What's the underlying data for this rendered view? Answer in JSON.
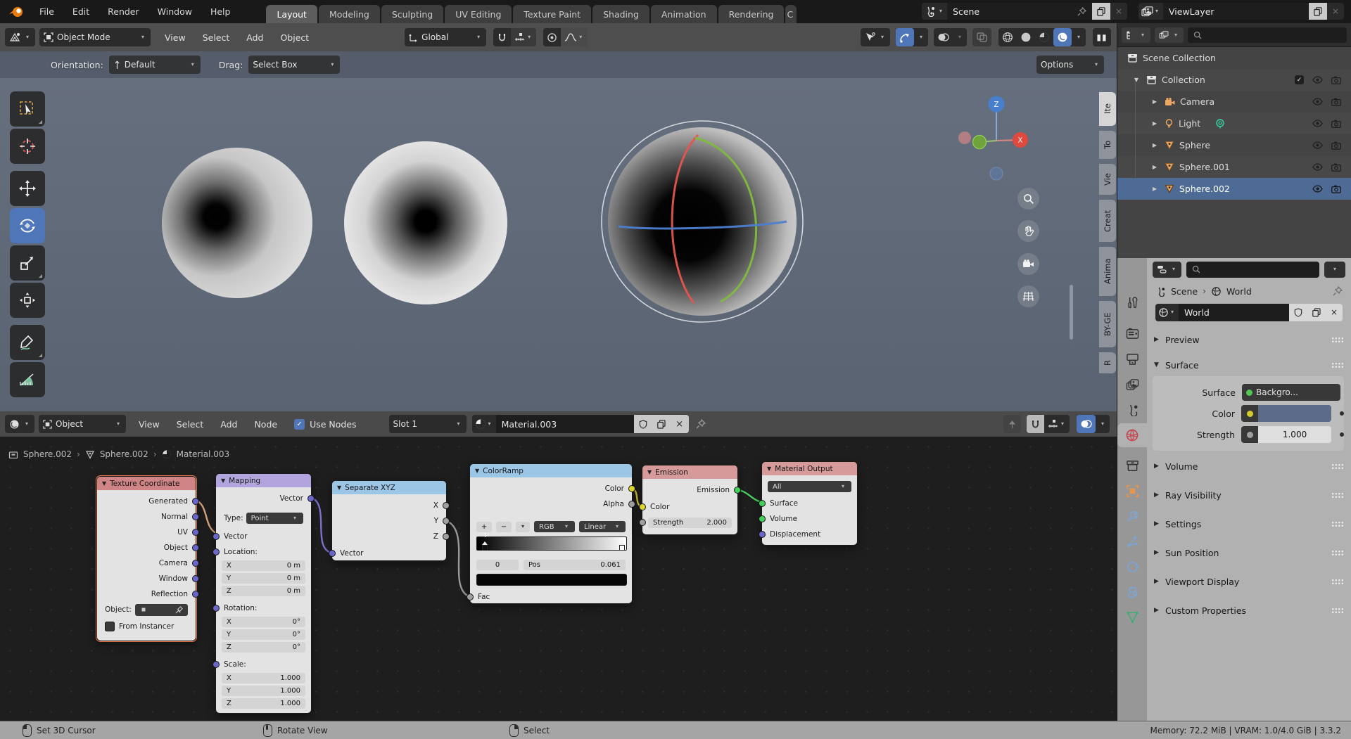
{
  "topbar": {
    "menus": [
      "File",
      "Edit",
      "Render",
      "Window",
      "Help"
    ],
    "tabs": [
      "Layout",
      "Modeling",
      "Sculpting",
      "UV Editing",
      "Texture Paint",
      "Shading",
      "Animation",
      "Rendering",
      "C"
    ],
    "scene": {
      "name": "Scene"
    },
    "view_layer": {
      "name": "ViewLayer"
    }
  },
  "viewport": {
    "header": {
      "mode": "Object Mode",
      "menus": [
        "View",
        "Select",
        "Add",
        "Object"
      ],
      "orientation": "Global"
    },
    "tool_settings": {
      "orientation_label": "Orientation:",
      "orientation_value": "Default",
      "drag_label": "Drag:",
      "drag_value": "Select Box",
      "options": "Options"
    },
    "axis_gizmo": {
      "z": "Z",
      "x": "X"
    },
    "sidebar_tabs": [
      "Ite",
      "To",
      "Vie",
      "Creat",
      "Anima",
      "BY-GE",
      "R"
    ]
  },
  "shader_editor": {
    "header": {
      "type": "Object",
      "menus": [
        "View",
        "Select",
        "Add",
        "Node"
      ],
      "use_nodes": "Use Nodes",
      "slot": "Slot 1",
      "material": "Material.003"
    },
    "breadcrumb": {
      "object": "Sphere.002",
      "data": "Sphere.002",
      "material": "Material.003"
    }
  },
  "nodes": {
    "texture_coordinate": {
      "title": "Texture Coordinate",
      "outputs": [
        "Generated",
        "Normal",
        "UV",
        "Object",
        "Camera",
        "Window",
        "Reflection"
      ],
      "object_label": "Object:",
      "from_instancer": "From Instancer"
    },
    "mapping": {
      "title": "Mapping",
      "output": "Vector",
      "type_label": "Type:",
      "type_value": "Point",
      "input": "Vector",
      "location_label": "Location:",
      "rotation_label": "Rotation:",
      "scale_label": "Scale:",
      "axis_x": "X",
      "axis_y": "Y",
      "axis_z": "Z",
      "location": {
        "x": "0 m",
        "y": "0 m",
        "z": "0 m"
      },
      "rotation": {
        "x": "0°",
        "y": "0°",
        "z": "0°"
      },
      "scale": {
        "x": "1.000",
        "y": "1.000",
        "z": "1.000"
      }
    },
    "separate_xyz": {
      "title": "Separate XYZ",
      "outputs": [
        "X",
        "Y",
        "Z"
      ],
      "input": "Vector"
    },
    "color_ramp": {
      "title": "ColorRamp",
      "outputs": [
        "Color",
        "Alpha"
      ],
      "add": "+",
      "remove": "−",
      "color_mode": "RGB",
      "interpolation": "Linear",
      "index": "0",
      "pos_label": "Pos",
      "pos_value": "0.061",
      "input": "Fac"
    },
    "emission": {
      "title": "Emission",
      "output": "Emission",
      "color_label": "Color",
      "strength_label": "Strength",
      "strength_value": "2.000"
    },
    "material_output": {
      "title": "Material Output",
      "target": "All",
      "inputs": [
        "Surface",
        "Volume",
        "Displacement"
      ]
    }
  },
  "outliner": {
    "items": [
      {
        "label": "Scene Collection"
      },
      {
        "label": "Collection"
      },
      {
        "label": "Camera"
      },
      {
        "label": "Light"
      },
      {
        "label": "Sphere"
      },
      {
        "label": "Sphere.001"
      },
      {
        "label": "Sphere.002"
      }
    ]
  },
  "properties": {
    "breadcrumb": {
      "scene": "Scene",
      "world": "World"
    },
    "datablock_name": "World",
    "panels": {
      "preview": "Preview",
      "surface": "Surface",
      "volume": "Volume",
      "ray_visibility": "Ray Visibility",
      "settings": "Settings",
      "sun_position": "Sun Position",
      "viewport_display": "Viewport Display",
      "custom_properties": "Custom Properties"
    },
    "surface": {
      "surface_label": "Surface",
      "surface_value": "Backgro...",
      "color_label": "Color",
      "strength_label": "Strength",
      "strength_value": "1.000"
    }
  },
  "statusbar": {
    "hints": [
      {
        "label": "Set 3D Cursor"
      },
      {
        "label": "Rotate View"
      },
      {
        "label": "Select"
      }
    ],
    "stats": "Memory: 72.2 MiB | VRAM: 1.0/4.0 GiB | 3.3.2"
  },
  "colors": {
    "accent_blue": "#4f76b8",
    "world_color": "#5c6b88",
    "selected_row": "#4e6b96",
    "node_header_red": "#d18e8e",
    "node_header_blue": "#9cc6e6",
    "node_header_purple": "#b2a4dc"
  }
}
